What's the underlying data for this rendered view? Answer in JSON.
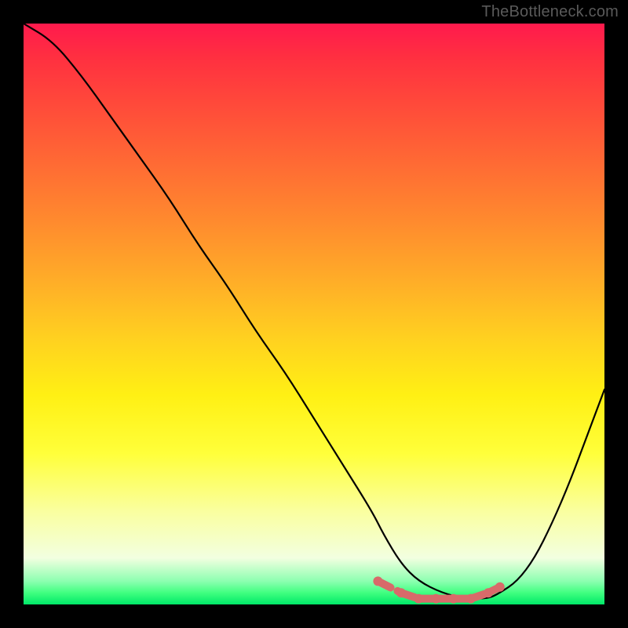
{
  "attribution": "TheBottleneck.com",
  "chart_data": {
    "type": "line",
    "title": "",
    "xlabel": "",
    "ylabel": "",
    "xlim": [
      0,
      100
    ],
    "ylim": [
      0,
      100
    ],
    "grid": false,
    "legend": false,
    "background": "rainbow-gradient-red-to-green",
    "series": [
      {
        "name": "curve",
        "color": "#000000",
        "x": [
          0,
          5,
          10,
          15,
          20,
          25,
          30,
          35,
          40,
          45,
          50,
          55,
          60,
          62,
          65,
          68,
          72,
          76,
          80,
          82,
          85,
          88,
          91,
          94,
          97,
          100
        ],
        "y": [
          100,
          97,
          91,
          84,
          77,
          70,
          62,
          55,
          47,
          40,
          32,
          24,
          16,
          12,
          7,
          4,
          2,
          1,
          1,
          2,
          4,
          8,
          14,
          21,
          29,
          37
        ]
      },
      {
        "name": "valley-markers",
        "type": "scatter",
        "color": "#d86a6a",
        "x": [
          61,
          65,
          68,
          71,
          74,
          77,
          80,
          82
        ],
        "y": [
          4,
          2,
          1,
          1,
          1,
          1,
          2,
          3
        ]
      }
    ]
  }
}
